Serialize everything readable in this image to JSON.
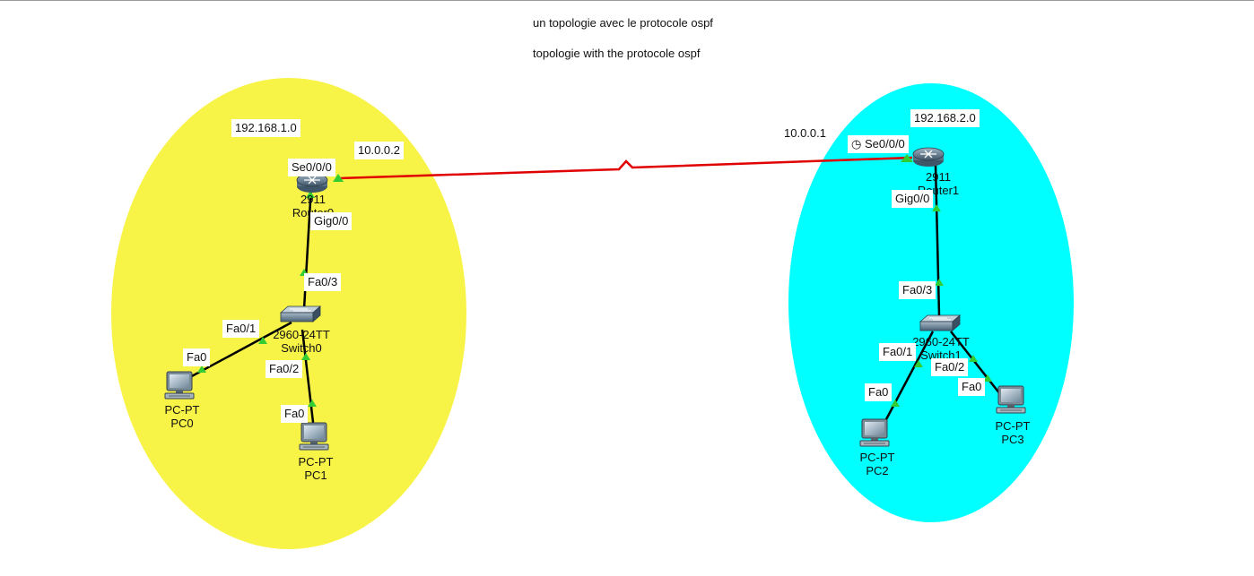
{
  "notes": [
    "un topologie avec le protocole ospf",
    "topologie with the protocole ospf"
  ],
  "colors": {
    "zone_left": "#f8f347",
    "zone_right": "#00ffff",
    "serial_link": "#e00000",
    "ethernet_link": "#000000",
    "port_up": "#33cc33",
    "top_border": "#9a9a9a"
  },
  "networks": {
    "left": "192.168.1.0",
    "right": "192.168.2.0"
  },
  "serial_ips": {
    "left": "10.0.0.2",
    "right": "10.0.0.1"
  },
  "devices": {
    "router0": {
      "model": "2911",
      "name": "Router0",
      "icon": "router-icon"
    },
    "router1": {
      "model": "2911",
      "name": "Router1",
      "icon": "router-icon"
    },
    "switch0": {
      "model": "2960-24TT",
      "name": "Switch0",
      "icon": "switch-icon"
    },
    "switch1": {
      "model": "2960-24TT",
      "name": "Switch1",
      "icon": "switch-icon"
    },
    "pc0": {
      "model": "PC-PT",
      "name": "PC0",
      "icon": "pc-icon"
    },
    "pc1": {
      "model": "PC-PT",
      "name": "PC1",
      "icon": "pc-icon"
    },
    "pc2": {
      "model": "PC-PT",
      "name": "PC2",
      "icon": "pc-icon"
    },
    "pc3": {
      "model": "PC-PT",
      "name": "PC3",
      "icon": "pc-icon"
    }
  },
  "ports": {
    "r0_serial": "Se0/0/0",
    "r0_gig": "Gig0/0",
    "s0_uplink": "Fa0/3",
    "s0_p1": "Fa0/1",
    "s0_p2": "Fa0/2",
    "pc0_nic": "Fa0",
    "pc1_nic": "Fa0",
    "r1_serial": "Se0/0/0",
    "r1_gig": "Gig0/0",
    "s1_uplink": "Fa0/3",
    "s1_p1": "Fa0/1",
    "s1_p2": "Fa0/2",
    "pc2_nic": "Fa0",
    "pc3_nic": "Fa0"
  },
  "serial_clock_icon": "clock-icon"
}
